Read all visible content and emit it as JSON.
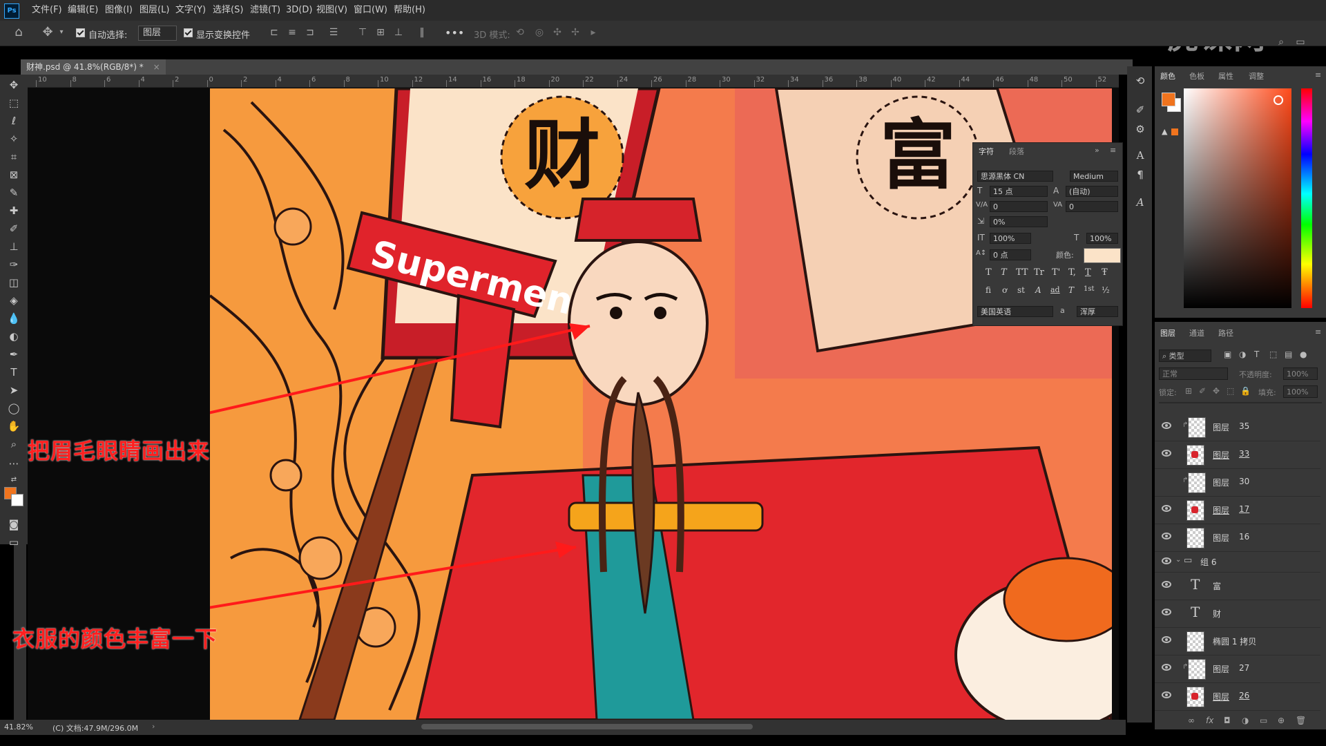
{
  "app": {
    "logo": "Ps"
  },
  "menu": [
    "文件(F)",
    "编辑(E)",
    "图像(I)",
    "图层(L)",
    "文字(Y)",
    "选择(S)",
    "滤镜(T)",
    "3D(D)",
    "视图(V)",
    "窗口(W)",
    "帮助(H)"
  ],
  "options": {
    "auto_select_label": "自动选择:",
    "auto_select_value": "图层",
    "show_transform_label": "显示变换控件",
    "mode_3d_label": "3D 模式:",
    "more": "•••"
  },
  "watermark": "虎课网",
  "document": {
    "tab_title": "财神.psd @ 41.8%(RGB/8*) *",
    "close": "×"
  },
  "ruler_top_labels": [
    "10",
    "8",
    "6",
    "4",
    "2",
    "0",
    "2",
    "4",
    "6",
    "8",
    "10",
    "12",
    "14",
    "16",
    "18",
    "20",
    "22",
    "24",
    "26",
    "28",
    "30",
    "32",
    "34",
    "36",
    "38",
    "40",
    "42",
    "44",
    "46",
    "48",
    "50",
    "52"
  ],
  "artwork": {
    "sign_left": "财",
    "sign_right": "富",
    "gun_text": "Supermen"
  },
  "annotations": {
    "top": "把眉毛眼睛画出来",
    "bottom": "衣服的颜色丰富一下"
  },
  "character_panel": {
    "tabs": [
      "字符",
      "段落"
    ],
    "font_family": "思源黑体 CN",
    "font_style": "Medium",
    "size": "15 点",
    "leading": "(自动)",
    "kerning": "0",
    "tracking": "0",
    "scale_small": "0%",
    "vertical_scale": "100%",
    "horizontal_scale": "100%",
    "baseline": "0 点",
    "color_label": "颜色:",
    "language": "美国英语",
    "aa_label": "a",
    "antialias": "浑厚",
    "text_buttons": [
      "T",
      "T",
      "TT",
      "Tr",
      "T'",
      "T,",
      "T",
      "Ŧ"
    ],
    "ot_buttons": [
      "fi",
      "ơ",
      "st",
      "A",
      "ad",
      "T",
      "1st",
      "½"
    ]
  },
  "color_panel": {
    "tabs": [
      "颜色",
      "色板",
      "属性",
      "调整"
    ],
    "fg": "#f0741e",
    "bg": "#ffffff"
  },
  "layers_panel": {
    "tabs": [
      "图层",
      "通道",
      "路径"
    ],
    "filter_label": "类型",
    "blend_mode": "正常",
    "opacity_label": "不透明度:",
    "opacity_value": "100%",
    "lock_label": "锁定:",
    "fill_label": "填充:",
    "fill_value": "100%",
    "layers": [
      {
        "name": "图层",
        "num": "35",
        "type": "clip"
      },
      {
        "name": "图层",
        "num": "33",
        "type": "red"
      },
      {
        "name": "图层",
        "num": "30",
        "type": "clip"
      },
      {
        "name": "图层",
        "num": "17",
        "type": "red"
      },
      {
        "name": "图层",
        "num": "16",
        "type": "plain"
      },
      {
        "name": "组 6",
        "num": "",
        "type": "group"
      },
      {
        "name": "富",
        "num": "",
        "type": "text"
      },
      {
        "name": "财",
        "num": "",
        "type": "text"
      },
      {
        "name": "椭圆 1 拷贝",
        "num": "",
        "type": "plain"
      },
      {
        "name": "图层",
        "num": "27",
        "type": "clip"
      },
      {
        "name": "图层",
        "num": "26",
        "type": "red"
      }
    ]
  },
  "status": {
    "zoom": "41.82%",
    "doc_info": "(C) 文档:47.9M/296.0M"
  }
}
